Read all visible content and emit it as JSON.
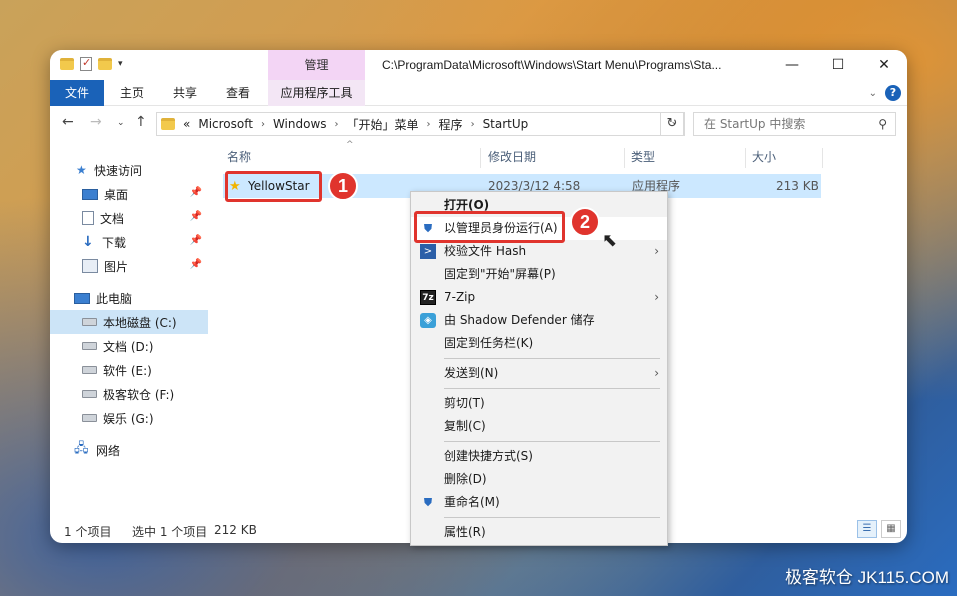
{
  "title_bar": {
    "manage_tab": "管理",
    "path": "C:\\ProgramData\\Microsoft\\Windows\\Start Menu\\Programs\\Sta...",
    "minimize": "—",
    "maximize": "☐",
    "close": "✕"
  },
  "ribbon": {
    "tabs": [
      "文件",
      "主页",
      "共享",
      "查看"
    ],
    "app_tools": "应用程序工具"
  },
  "address": {
    "prefix": "«",
    "crumbs": [
      "Microsoft",
      "Windows",
      "「开始」菜单",
      "程序",
      "StartUp"
    ],
    "search_placeholder": "在 StartUp 中搜索"
  },
  "sidebar": {
    "items": [
      {
        "label": "快速访问",
        "icon": "star-icon"
      },
      {
        "label": "桌面",
        "icon": "desktop-icon"
      },
      {
        "label": "文档",
        "icon": "document-icon"
      },
      {
        "label": "下载",
        "icon": "download-icon"
      },
      {
        "label": "图片",
        "icon": "pictures-icon"
      },
      {
        "label": "此电脑",
        "icon": "pc-icon"
      },
      {
        "label": "本地磁盘 (C:)",
        "icon": "drive-icon"
      },
      {
        "label": "文档 (D:)",
        "icon": "drive-icon"
      },
      {
        "label": "软件 (E:)",
        "icon": "drive-icon"
      },
      {
        "label": "极客软仓 (F:)",
        "icon": "drive-icon"
      },
      {
        "label": "娱乐 (G:)",
        "icon": "drive-icon"
      },
      {
        "label": "网络",
        "icon": "network-icon"
      }
    ]
  },
  "columns": {
    "name": "名称",
    "modified": "修改日期",
    "type": "类型",
    "size": "大小"
  },
  "files": [
    {
      "name": "YellowStar",
      "modified": "2023/3/12 4:58",
      "type": "应用程序",
      "size": "213 KB"
    }
  ],
  "status": {
    "count": "1 个项目",
    "selected": "选中 1 个项目",
    "size": "212 KB"
  },
  "context_menu": {
    "items": [
      "打开(O)",
      "以管理员身份运行(A)",
      "校验文件 Hash",
      "固定到\"开始\"屏幕(P)",
      "7-Zip",
      "由 Shadow Defender 储存",
      "固定到任务栏(K)",
      "发送到(N)",
      "剪切(T)",
      "复制(C)",
      "创建快捷方式(S)",
      "删除(D)",
      "重命名(M)",
      "属性(R)"
    ]
  },
  "callouts": [
    "1",
    "2"
  ],
  "watermark": "极客软仓 JK115.COM",
  "colors": {
    "accent": "#1a62b8",
    "selection": "#cce8ff",
    "callout_red": "#e0342d",
    "manage_tab": "#f3d5f5"
  }
}
